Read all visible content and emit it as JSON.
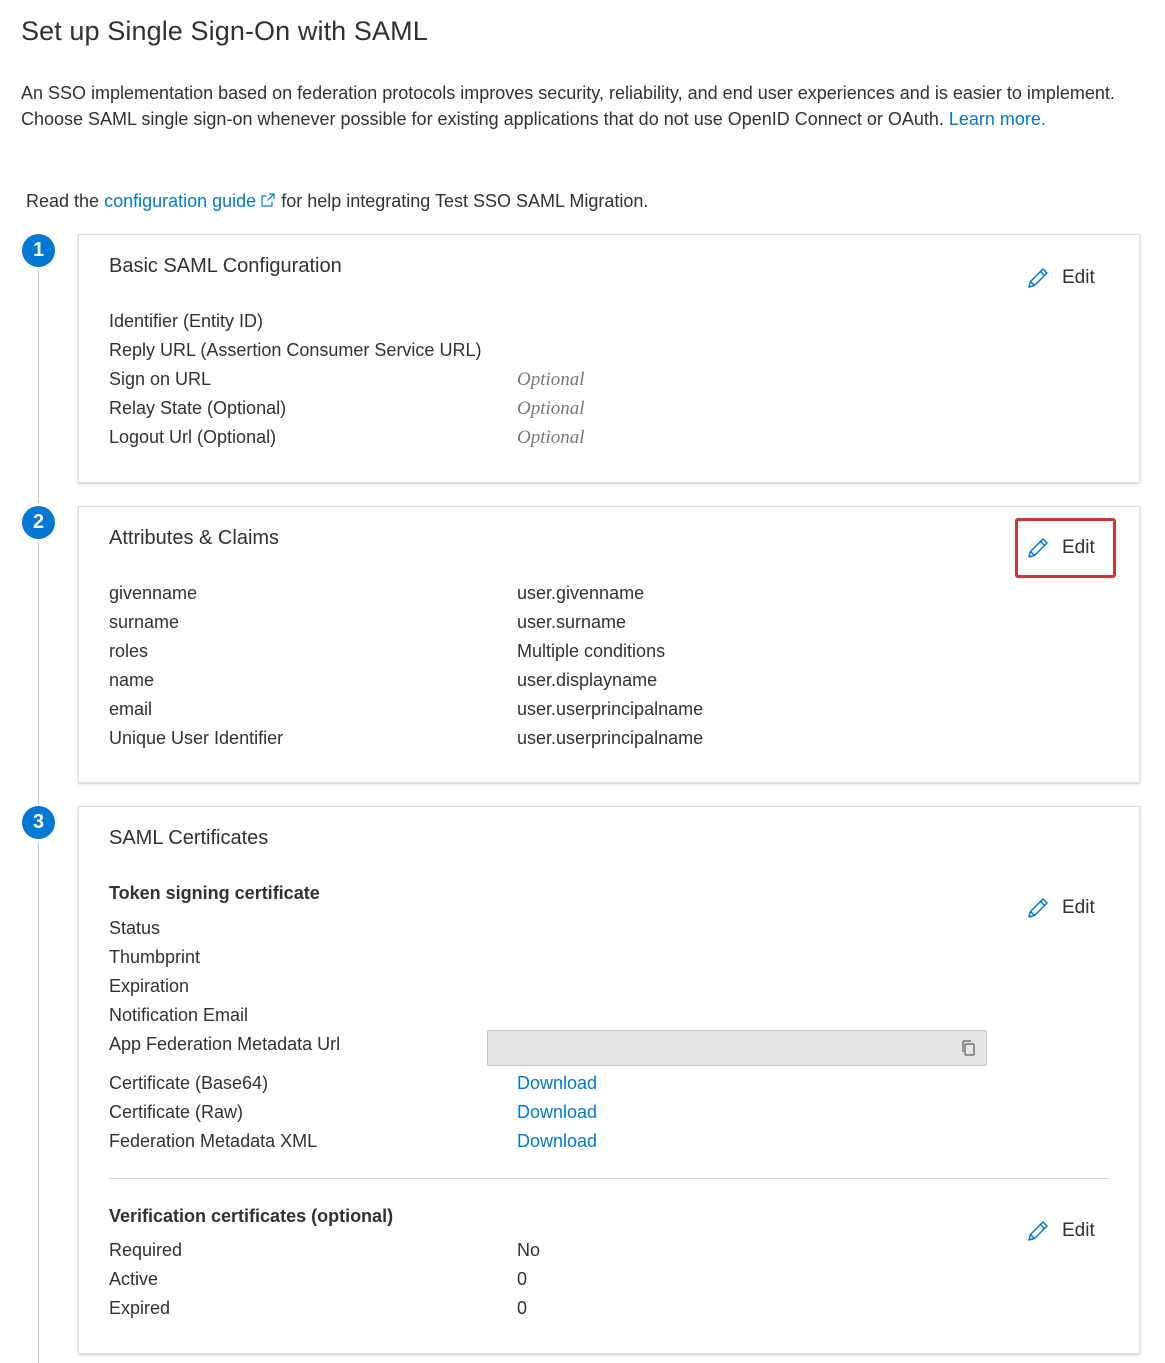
{
  "page": {
    "title": "Set up Single Sign-On with SAML",
    "intro_text": "An SSO implementation based on federation protocols improves security, reliability, and end user experiences and is easier to implement. Choose SAML single sign-on whenever possible for existing applications that do not use OpenID Connect or OAuth.",
    "learn_more": "Learn more.",
    "guide_prefix": "Read the",
    "guide_link": "configuration guide",
    "guide_suffix": "for help integrating Test SSO SAML Migration."
  },
  "sections": [
    {
      "step": "1",
      "title": "Basic SAML Configuration",
      "edit_label": "Edit",
      "rows": [
        {
          "label": "Identifier (Entity ID)",
          "value": ""
        },
        {
          "label": "Reply URL (Assertion Consumer Service URL)",
          "value": ""
        },
        {
          "label": "Sign on URL",
          "value": "Optional"
        },
        {
          "label": "Relay State (Optional)",
          "value": "Optional"
        },
        {
          "label": "Logout Url (Optional)",
          "value": "Optional"
        }
      ]
    },
    {
      "step": "2",
      "title": "Attributes & Claims",
      "edit_label": "Edit",
      "rows": [
        {
          "label": "givenname",
          "value": "user.givenname"
        },
        {
          "label": "surname",
          "value": "user.surname"
        },
        {
          "label": "roles",
          "value": "Multiple conditions"
        },
        {
          "label": "name",
          "value": "user.displayname"
        },
        {
          "label": "email",
          "value": "user.userprincipalname"
        },
        {
          "label": "Unique User Identifier",
          "value": "user.userprincipalname"
        }
      ]
    },
    {
      "step": "3",
      "title": "SAML Certificates",
      "token": {
        "heading": "Token signing certificate",
        "edit_label": "Edit",
        "rows": [
          {
            "label": "Status",
            "value": ""
          },
          {
            "label": "Thumbprint",
            "value": ""
          },
          {
            "label": "Expiration",
            "value": ""
          },
          {
            "label": "Notification Email",
            "value": ""
          },
          {
            "label": "App Federation Metadata Url",
            "value": ""
          },
          {
            "label": "Certificate (Base64)",
            "value": "Download"
          },
          {
            "label": "Certificate (Raw)",
            "value": "Download"
          },
          {
            "label": "Federation Metadata XML",
            "value": "Download"
          }
        ]
      },
      "verification": {
        "heading": "Verification certificates (optional)",
        "edit_label": "Edit",
        "rows": [
          {
            "label": "Required",
            "value": "No"
          },
          {
            "label": "Active",
            "value": "0"
          },
          {
            "label": "Expired",
            "value": "0"
          }
        ]
      }
    }
  ],
  "colors": {
    "accent": "#0078d4",
    "highlight_border": "#d13438"
  },
  "icons": {
    "edit": "pencil-icon",
    "copy": "copy-icon",
    "external_link": "external-link-icon"
  }
}
